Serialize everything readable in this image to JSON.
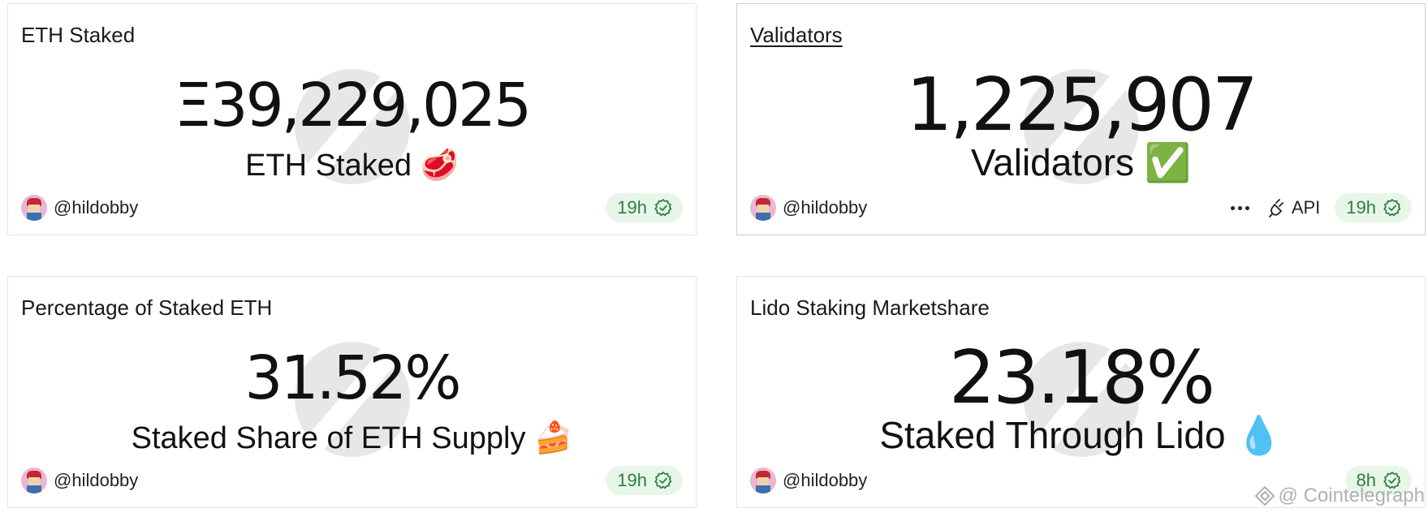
{
  "cards": [
    {
      "title": "ETH Staked",
      "value": "Ξ39,229,025",
      "subtitle": "ETH Staked 🥩",
      "author": "@hildobby",
      "freshness": "19h"
    },
    {
      "title": "Validators",
      "value": "1,225,907",
      "subtitle": "Validators ✅",
      "author": "@hildobby",
      "api_label": "API",
      "freshness": "19h"
    },
    {
      "title": "Percentage of Staked ETH",
      "value": "31.52%",
      "subtitle": "Staked Share of ETH Supply 🍰",
      "author": "@hildobby",
      "freshness": "19h"
    },
    {
      "title": "Lido Staking Marketshare",
      "value": "23.18%",
      "subtitle": "Staked Through Lido 💧",
      "author": "@hildobby",
      "freshness": "8h"
    }
  ],
  "watermark": {
    "label": "@ Cointelegraph"
  },
  "colors": {
    "freshness_bg": "#e8f6ea",
    "freshness_text": "#2e7d45",
    "card_border": "#e6e6e6",
    "text": "#111111"
  },
  "icons": {
    "freshness": "check-badge-icon",
    "api": "plug-icon",
    "more": "more-dots-icon",
    "brand": "cointelegraph-icon"
  }
}
